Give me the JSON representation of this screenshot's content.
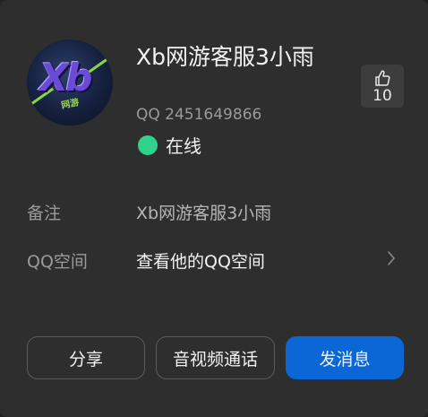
{
  "profile": {
    "name": "Xb网游客服3小雨",
    "qq_number": "QQ 2451649866",
    "status": "在线",
    "status_color": "#2fd18c",
    "avatar": {
      "logo_text": "Xb",
      "logo_sub": "网游"
    }
  },
  "likes": {
    "icon": "thumbs-up-icon",
    "count": "10"
  },
  "details": {
    "remark_label": "备注",
    "remark_value": "Xb网游客服3小雨",
    "qzone_label": "QQ空间",
    "qzone_value": "查看他的QQ空间"
  },
  "actions": {
    "share_label": "分享",
    "call_label": "音视频通话",
    "message_label": "发消息"
  },
  "colors": {
    "background": "#2e2e2e",
    "primary": "#0b66d6"
  }
}
